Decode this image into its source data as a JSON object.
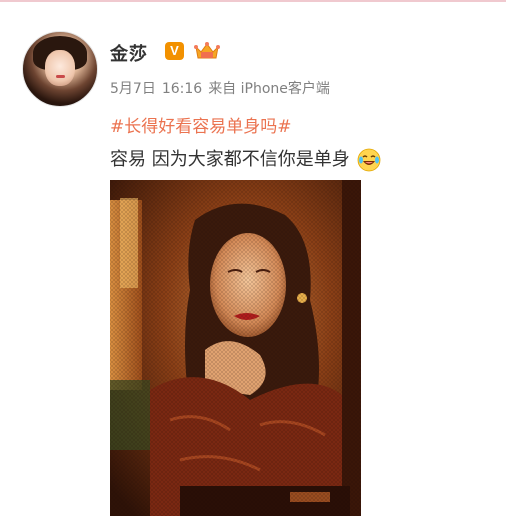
{
  "post": {
    "author": "金莎",
    "verified_badge_text": "V",
    "member_badge_icon": "crown-icon",
    "date": "5月7日",
    "time": "16:16",
    "source": "来自 iPhone客户端",
    "hashtag": "#长得好看容易单身吗#",
    "text": "容易 因为大家都不信你是单身",
    "emoji_icon": "laugh-cry-emoji-icon",
    "image_icon": "portrait-photo",
    "colors": {
      "hashtag": "#eb7350",
      "meta": "#808080",
      "name": "#333333",
      "verified": "#f29100"
    }
  }
}
